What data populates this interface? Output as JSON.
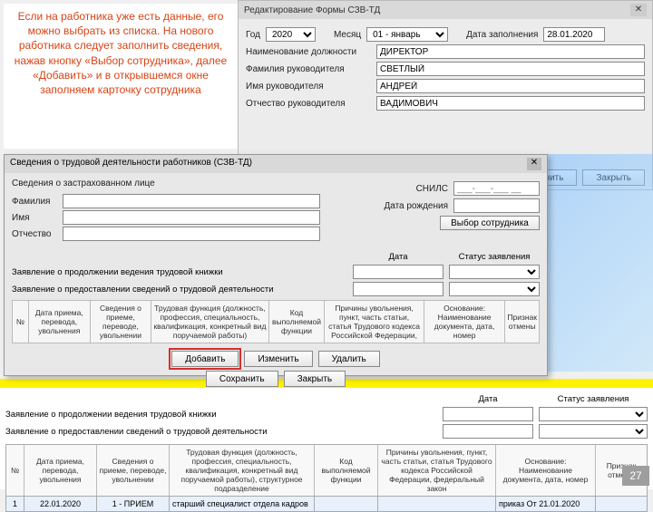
{
  "note_text": "Если на работника уже есть данные, его можно выбрать из списка. На нового работника следует заполнить сведения, нажав кнопку «Выбор сотрудника», далее «Добавить» и в открывшемся окне заполняем карточку сотрудника",
  "topwin": {
    "title": "Редактирование Формы СЗВ-ТД",
    "year_lbl": "Год",
    "year_val": "2020",
    "month_lbl": "Месяц",
    "month_val": "01 - январь",
    "date_lbl": "Дата заполнения",
    "date_val": "28.01.2020",
    "position_lbl": "Наименование должности",
    "position_val": "ДИРЕКТОР",
    "surname_lbl": "Фамилия руководителя",
    "surname_val": "СВЕТЛЫЙ",
    "name_lbl": "Имя руководителя",
    "name_val": "АНДРЕЙ",
    "patr_lbl": "Отчество руководителя",
    "patr_val": "ВАДИМОВИЧ",
    "btn_mid": "нить",
    "btn_close": "Закрыть"
  },
  "dialog": {
    "title": "Сведения о трудовой деятельности работников (СЗВ-ТД)",
    "group": "Сведения о застрахованном лице",
    "fam_lbl": "Фамилия",
    "name_lbl": "Имя",
    "patr_lbl": "Отчество",
    "snils_lbl": "СНИЛС",
    "snils_ph": "___-___-___ __",
    "birth_lbl": "Дата рождения",
    "choose_btn": "Выбор сотрудника",
    "date_hdr": "Дата",
    "status_hdr": "Статус заявления",
    "decl1": "Заявление о продолжении ведения трудовой книжки",
    "decl2": "Заявление о предоставлении сведений о трудовой деятельности",
    "th": [
      "№",
      "Дата приема, перевода, увольнения",
      "Сведения о приеме, переводе, увольнении",
      "Трудовая функция (должность, профессия, специальность, квалификация, конкретный вид поручаемой работы)",
      "Код выполняемой функции",
      "Причины увольнения, пункт, часть статьи, статья Трудового кодекса Российской Федерации,",
      "Основание: Наименование документа, дата, номер",
      "Признак отмены"
    ],
    "btn_add": "Добавить",
    "btn_edit": "Изменить",
    "btn_del": "Удалить",
    "btn_save": "Сохранить",
    "btn_close": "Закрыть"
  },
  "bottom": {
    "decl1": "Заявление о продолжении ведения трудовой книжки",
    "decl2": "Заявление о предоставлении сведений о трудовой деятельности",
    "date_hdr": "Дата",
    "status_hdr": "Статус заявления",
    "th": [
      "№",
      "Дата приема, перевода, увольнения",
      "Сведения о приеме, переводе, увольнении",
      "Трудовая функция (должность, профессия, специальность, квалификация, конкретный вид поручаемой работы), структурное подразделение",
      "Код выполняемой функции",
      "Причины увольнения, пункт, часть статьи, статья Трудового кодекса Российской Федерации, федеральный закон",
      "Основание: Наименование документа, дата, номер",
      "Признак отмены"
    ],
    "row": {
      "n": "1",
      "date": "22.01.2020",
      "event": "1 - ПРИЕМ",
      "func": "старший специалист отдела кадров",
      "code": "",
      "reason": "",
      "basis": "приказ От 21.01.2020"
    }
  },
  "page_number": "27"
}
